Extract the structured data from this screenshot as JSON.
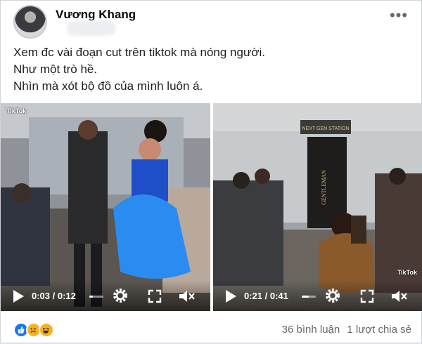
{
  "post": {
    "author": "Vương Khang",
    "lines": [
      "Xem đc vài đoạn cut trên tiktok mà nóng người.",
      "Như một trò hề.",
      "Nhìn mà xót bộ đồ của mình luôn á."
    ]
  },
  "videos": [
    {
      "time": "0:03 / 0:12",
      "progress": 0.25,
      "watermark": "TikTok"
    },
    {
      "time": "0:21 / 0:41",
      "progress": 0.51,
      "watermark": "TikTok"
    }
  ],
  "scene_text": {
    "sign_top": "NEXT GEN STATION",
    "banner": "GENTLEMAN"
  },
  "footer": {
    "comments": "36 bình luận",
    "shares": "1 lượt chia sẻ"
  },
  "reactions": [
    "like-icon",
    "sad-icon",
    "haha-icon"
  ],
  "colors": {
    "like": "#1877f2",
    "emoji": "#f7b125",
    "meta": "#65676b"
  }
}
